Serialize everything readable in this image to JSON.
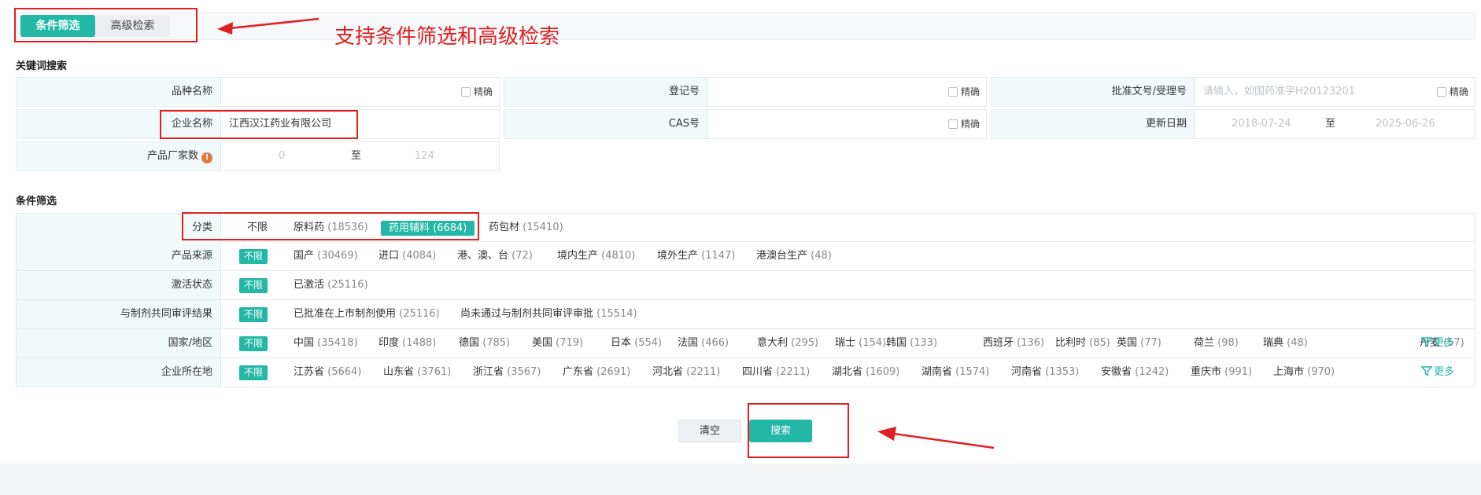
{
  "tabs": [
    {
      "label": "条件筛选",
      "active": true
    },
    {
      "label": "高级检索",
      "active": false
    }
  ],
  "annotations": {
    "top_text": "支持条件筛选和高级检索"
  },
  "keyword_section": {
    "title": "关键词搜索",
    "exact_label": "精确",
    "fields": {
      "variety_name": {
        "label": "品种名称",
        "value": ""
      },
      "reg_no": {
        "label": "登记号",
        "value": ""
      },
      "approval_no": {
        "label": "批准文号/受理号",
        "placeholder": "请输入，如国药准字H20123201"
      },
      "company_name": {
        "label": "企业名称",
        "value": "江西汉江药业有限公司"
      },
      "cas_no": {
        "label": "CAS号",
        "value": ""
      },
      "update_date": {
        "label": "更新日期",
        "from": "2018-07-24",
        "to": "2025-06-26",
        "sep": "至"
      },
      "manufacturer_count": {
        "label": "产品厂家数",
        "from": "0",
        "to": "124",
        "sep": "至",
        "info_icon": "info-icon"
      }
    }
  },
  "filter_section": {
    "title": "条件筛选",
    "more_label": "更多",
    "rows": [
      {
        "label": "分类",
        "options": [
          {
            "text": "不限",
            "count": ""
          },
          {
            "text": "原料药",
            "count": "(18536)"
          },
          {
            "text": "药用辅料",
            "count": "(6684)",
            "selected": true
          },
          {
            "text": "药包材",
            "count": "(15410)"
          }
        ]
      },
      {
        "label": "产品来源",
        "options": [
          {
            "text": "不限",
            "count": ""
          },
          {
            "text": "国产",
            "count": "(30469)"
          },
          {
            "text": "进口",
            "count": "(4084)"
          },
          {
            "text": "港、澳、台",
            "count": "(72)"
          },
          {
            "text": "境内生产",
            "count": "(4810)"
          },
          {
            "text": "境外生产",
            "count": "(1147)"
          },
          {
            "text": "港澳台生产",
            "count": "(48)"
          }
        ]
      },
      {
        "label": "激活状态",
        "options": [
          {
            "text": "不限",
            "count": ""
          },
          {
            "text": "已激活",
            "count": "(25116)"
          }
        ]
      },
      {
        "label": "与制剂共同审评结果",
        "options": [
          {
            "text": "不限",
            "count": ""
          },
          {
            "text": "已批准在上市制剂使用",
            "count": "(25116)"
          },
          {
            "text": "尚未通过与制剂共同审评审批",
            "count": "(15514)"
          }
        ]
      },
      {
        "label": "国家/地区",
        "options": [
          {
            "text": "不限",
            "count": ""
          },
          {
            "text": "中国",
            "count": "(35418)"
          },
          {
            "text": "印度",
            "count": "(1488)"
          },
          {
            "text": "德国",
            "count": "(785)"
          },
          {
            "text": "美国",
            "count": "(719)"
          },
          {
            "text": "日本",
            "count": "(554)"
          },
          {
            "text": "法国",
            "count": "(466)"
          },
          {
            "text": "意大利",
            "count": "(295)"
          },
          {
            "text": "瑞士",
            "count": "(154)"
          },
          {
            "text": "韩国",
            "count": "(133)"
          },
          {
            "text": "西班牙",
            "count": "(136)"
          },
          {
            "text": "比利时",
            "count": "(85)"
          },
          {
            "text": "英国",
            "count": "(77)"
          },
          {
            "text": "荷兰",
            "count": "(98)"
          },
          {
            "text": "瑞典",
            "count": "(48)"
          },
          {
            "text": "丹麦",
            "count": "(57)"
          }
        ]
      },
      {
        "label": "企业所在地",
        "options": [
          {
            "text": "不限",
            "count": ""
          },
          {
            "text": "江苏省",
            "count": "(5664)"
          },
          {
            "text": "山东省",
            "count": "(3761)"
          },
          {
            "text": "浙江省",
            "count": "(3567)"
          },
          {
            "text": "广东省",
            "count": "(2691)"
          },
          {
            "text": "河北省",
            "count": "(2211)"
          },
          {
            "text": "四川省",
            "count": "(2211)"
          },
          {
            "text": "湖北省",
            "count": "(1609)"
          },
          {
            "text": "湖南省",
            "count": "(1574)"
          },
          {
            "text": "河南省",
            "count": "(1353)"
          },
          {
            "text": "安徽省",
            "count": "(1242)"
          },
          {
            "text": "重庆市",
            "count": "(991)"
          },
          {
            "text": "上海市",
            "count": "(970)"
          }
        ]
      }
    ]
  },
  "actions": {
    "clear_label": "清空",
    "search_label": "搜索"
  },
  "colors": {
    "accent": "#23b7a6",
    "annotation_red": "#e02020",
    "label_bg": "#f1f9fb"
  }
}
